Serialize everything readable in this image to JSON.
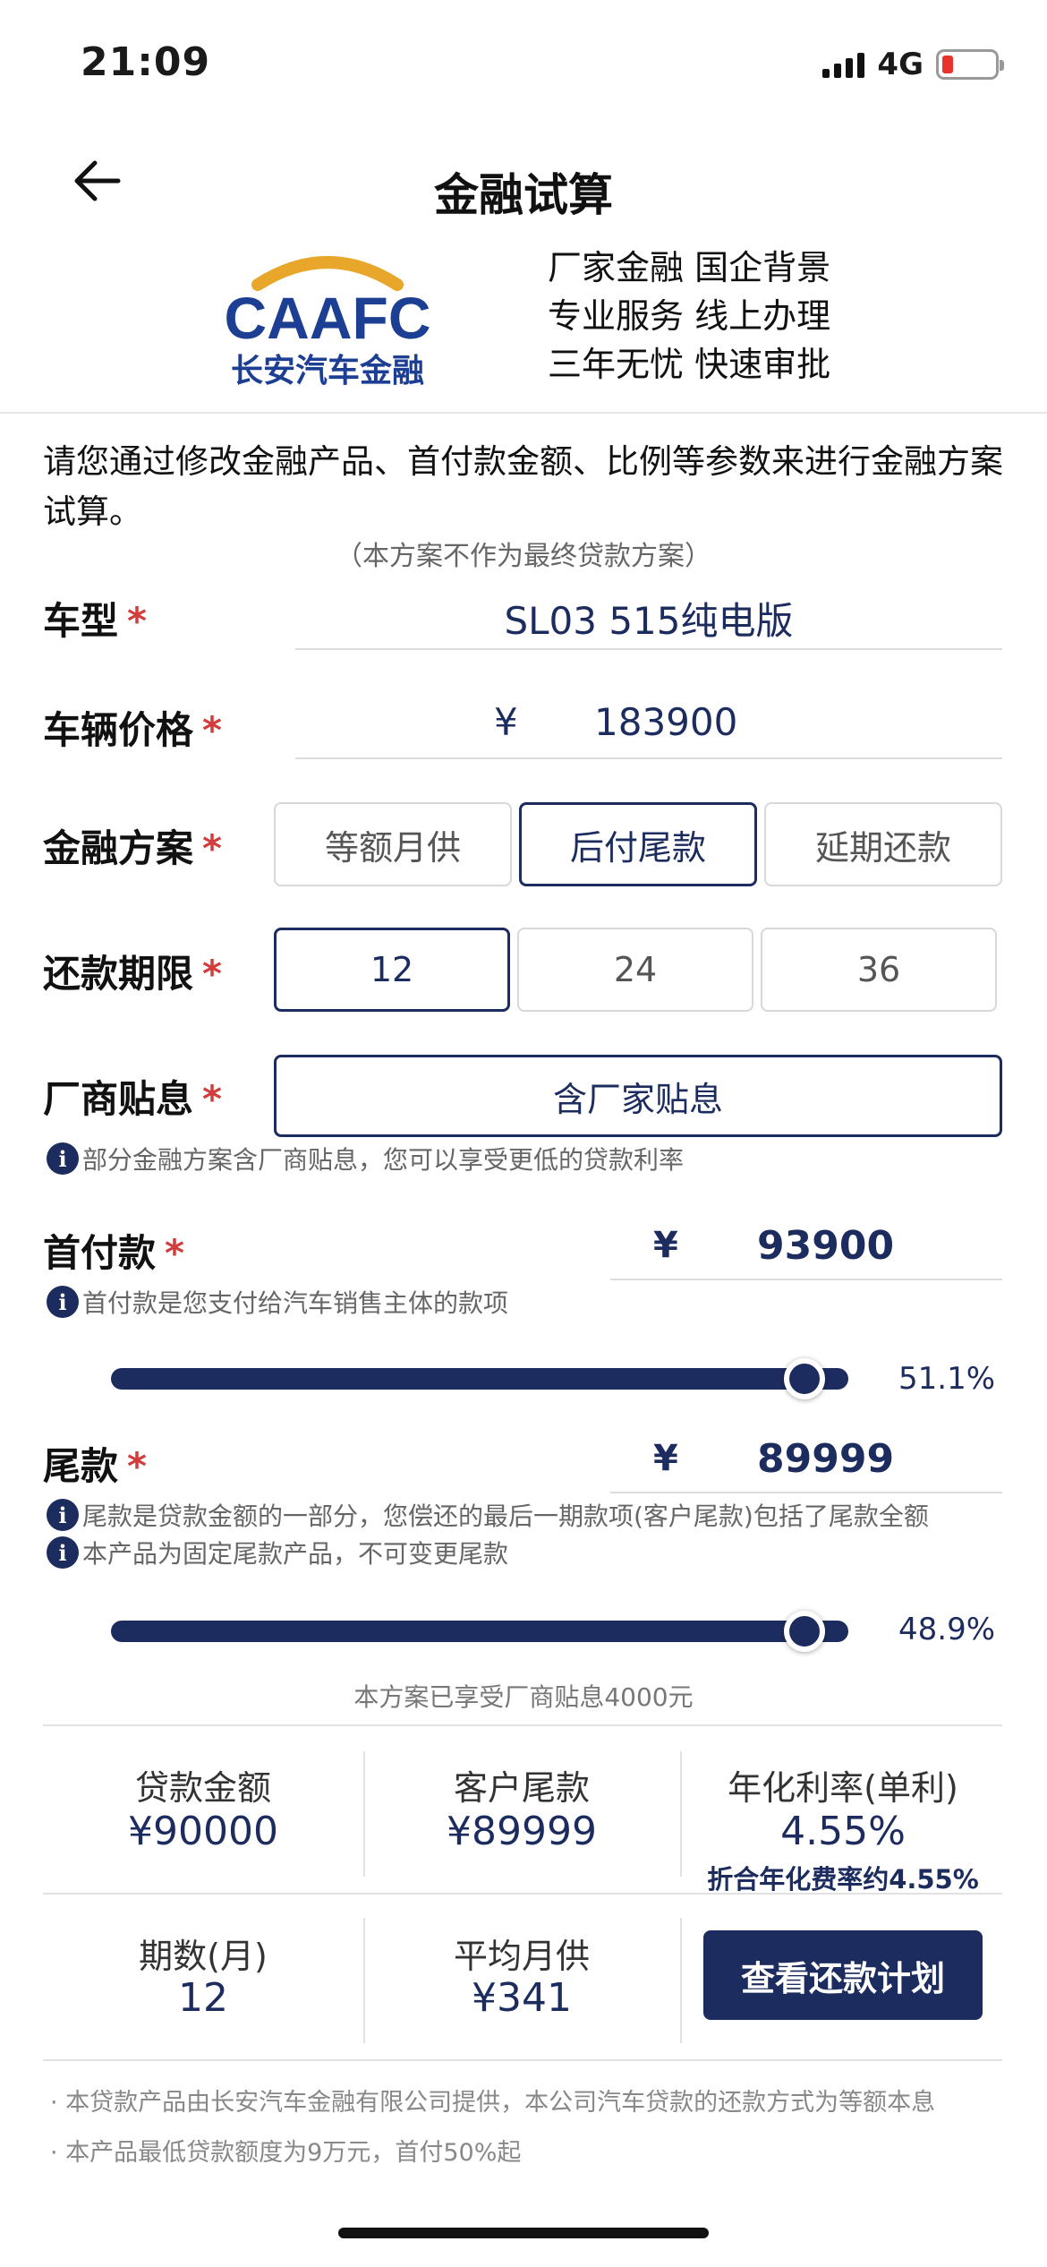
{
  "status_bar": {
    "time": "21:09",
    "network": "4G"
  },
  "nav": {
    "title": "金融试算",
    "back_icon": "arrow-left-icon"
  },
  "brand": {
    "logo_text": "CAAFC",
    "logo_subtext": "长安汽车金融",
    "logo_arc_color": "#e8a62a",
    "slogans": [
      "厂家金融 国企背景",
      "专业服务 线上办理",
      "三年无忧 快速审批"
    ]
  },
  "intro": "请您通过修改金融产品、首付款金额、比例等参数来进行金融方案试算。",
  "disclaimer": "（本方案不作为最终贷款方案）",
  "form": {
    "required_mark": "*",
    "model": {
      "label": "车型",
      "value": "SL03 515纯电版"
    },
    "price": {
      "label": "车辆价格",
      "currency": "¥",
      "value": "183900"
    },
    "plan": {
      "label": "金融方案",
      "options": [
        "等额月供",
        "后付尾款",
        "延期还款"
      ],
      "selected": "后付尾款"
    },
    "term": {
      "label": "还款期限",
      "options": [
        "12",
        "24",
        "36"
      ],
      "selected": "12"
    },
    "subsidy": {
      "label": "厂商贴息",
      "value": "含厂家贴息",
      "hint": "部分金融方案含厂商贴息，您可以享受更低的贷款利率"
    },
    "down_payment": {
      "label": "首付款",
      "currency": "¥",
      "value": "93900",
      "hint": "首付款是您支付给汽车销售主体的款项",
      "percent_text": "51.1%",
      "slider_fraction": 0.94
    },
    "balloon": {
      "label": "尾款",
      "currency": "¥",
      "value": "89999",
      "hints": [
        "尾款是贷款金额的一部分，您偿还的最后一期款项(客户尾款)包括了尾款全额",
        "本产品为固定尾款产品，不可变更尾款"
      ],
      "percent_text": "48.9%",
      "slider_fraction": 0.94
    }
  },
  "subsidy_note": "本方案已享受厂商贴息4000元",
  "summary": {
    "loan_amount": {
      "title": "贷款金额",
      "value": "¥90000"
    },
    "customer_balloon": {
      "title": "客户尾款",
      "value": "¥89999"
    },
    "annual_rate": {
      "title": "年化利率(单利)",
      "value": "4.55%",
      "sub": "折合年化费率约4.55%"
    },
    "periods": {
      "title": "期数(月)",
      "value": "12"
    },
    "avg_monthly": {
      "title": "平均月供",
      "value": "¥341"
    },
    "plan_button": "查看还款计划"
  },
  "footnotes": [
    "· 本贷款产品由长安汽车金融有限公司提供，本公司汽车贷款的还款方式为等额本息",
    "· 本产品最低贷款额度为9万元，首付50%起"
  ],
  "colors": {
    "primary": "#1c2c5e",
    "required": "#d23c3c"
  }
}
